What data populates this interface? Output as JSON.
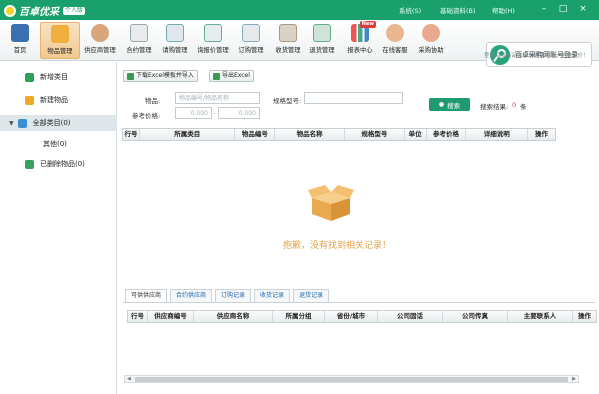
{
  "app": {
    "name": "百卓优采",
    "edition": "个人版"
  },
  "topmenu": {
    "system": "系统(S)",
    "basic": "基础资料(B)",
    "help": "帮助(H)"
  },
  "toolbar": {
    "items": [
      {
        "label": "首页"
      },
      {
        "label": "物品管理"
      },
      {
        "label": "供应商管理"
      },
      {
        "label": "合约管理"
      },
      {
        "label": "请购管理"
      },
      {
        "label": "询报价管理"
      },
      {
        "label": "订购管理"
      },
      {
        "label": "收货管理"
      },
      {
        "label": "退货管理"
      },
      {
        "label": "报表中心",
        "badge": "New"
      },
      {
        "label": "在线客服"
      },
      {
        "label": "采购协助"
      }
    ]
  },
  "promo": {
    "button": "百卓采购网账号登录",
    "sub": "登录后发商品询价单到百卓网，坐收报价！"
  },
  "sidebar": {
    "items": [
      {
        "label": "新增类目"
      },
      {
        "label": "新建物品"
      },
      {
        "label": "全部类目(0)"
      },
      {
        "label": "其他(0)"
      },
      {
        "label": "已删除物品(0)"
      }
    ]
  },
  "actions": {
    "import": "下载Excel模板并导入",
    "export": "导出Excel"
  },
  "filters": {
    "item_label": "物品:",
    "item_placeholder": "物品编号/物品名称",
    "spec_label": "规格型号:",
    "price_label": "参考价格:",
    "price_min": "0.000",
    "price_sep": "-",
    "price_max": "0.000",
    "search": "搜索",
    "result_label": "搜索结果:",
    "result_count": "0",
    "result_unit": "条"
  },
  "main_table": {
    "columns": [
      "行号",
      "所属类目",
      "物品编号",
      "物品名称",
      "规格型号",
      "单位",
      "参考价格",
      "详细说明",
      "操作"
    ]
  },
  "empty": {
    "message": "抱歉，没有找到相关记录！"
  },
  "tabs": [
    "可供供应商",
    "合约供应商",
    "订购记录",
    "收货记录",
    "退货记录"
  ],
  "supplier_table": {
    "columns": [
      "行号",
      "供应商编号",
      "供应商名称",
      "所属分组",
      "省份/城市",
      "公司固话",
      "公司传真",
      "主要联系人",
      "操作"
    ]
  },
  "colors": {
    "brand": "#1aa06d",
    "search": "#1f9a73",
    "empty_text": "#e0a24a"
  }
}
